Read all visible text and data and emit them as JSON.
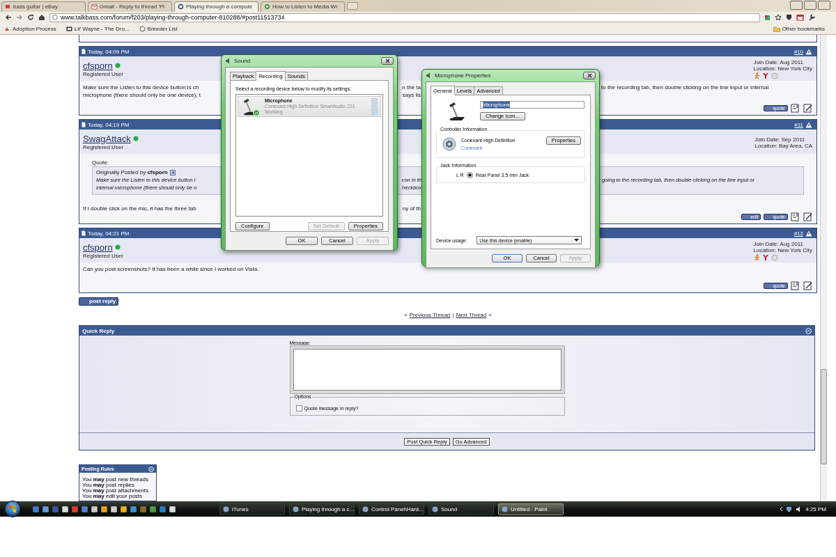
{
  "browser": {
    "tabs": [
      {
        "label": "bass guitar | eBay",
        "selected": false
      },
      {
        "label": "Gmail - Reply to thread 'Pl",
        "selected": false
      },
      {
        "label": "Playing through a compute",
        "selected": true
      },
      {
        "label": "How to Listen to Media Wi",
        "selected": false
      }
    ],
    "address": "www.talkbass.com/forum/f203/playing-through-computer-810288/#post11513734",
    "bookmarks": [
      "Adoption Process",
      "Lil' Wayne - The Dro...",
      "Breeder List"
    ],
    "other_bookmarks": "Other bookmarks"
  },
  "posts": [
    {
      "date": "Today, 04:09 PM",
      "number": "#10",
      "user": "cfsporn",
      "online": true,
      "rank": "Registered User",
      "join_date": "Join Date: Aug 2011",
      "location": "Location: New York City",
      "contact_icons": true,
      "body": [
        [
          "Make sure the Listen to this device button is ch",
          "n the ta",
          "to the recording tab, then double clicking on the line input or internal"
        ],
        [
          "microphone (there should only be one device), t",
          "says lis"
        ]
      ],
      "buttons": [
        "quote"
      ]
    },
    {
      "date": "Today, 04:19 PM",
      "number": "#11",
      "user": "SwagAttack",
      "online": true,
      "rank": "Registered User",
      "join_date": "Join Date: Sep 2011",
      "location": "Location: Bay Area, CA",
      "contact_icons": false,
      "quote": {
        "label": "Quote:",
        "by": "Originally Posted by **cfsporn**",
        "lines": [
          [
            "Make sure the Listen to this device button i",
            "con in th",
            "going to the recording tab, then double clicking on the line input or"
          ],
          [
            "internal microphone (there should only be o",
            "heckbox"
          ]
        ]
      },
      "body": [
        [
          "If I double click on the mic, it has the three tab",
          "ny of th"
        ]
      ],
      "buttons": [
        "edit",
        "quote"
      ]
    },
    {
      "date": "Today, 04:21 PM",
      "number": "#12",
      "user": "cfsporn",
      "online": true,
      "rank": "Registered User",
      "join_date": "Join Date: Aug 2011",
      "location": "Location: New York City",
      "contact_icons": true,
      "body": [
        [
          "Can you post screenshots? It has been a while since I worked on Vista."
        ]
      ],
      "buttons": [
        "quote"
      ]
    }
  ],
  "post_reply": "post reply",
  "thread_nav": {
    "left_mark": "«",
    "previous": "Previous Thread",
    "separator": "|",
    "next": "Next Thread",
    "right_mark": "»"
  },
  "quick_reply": {
    "title": "Quick Reply",
    "message_label": "Message:",
    "options_legend": "Options",
    "quote_option": {
      "label": "Quote message in reply?",
      "checked": false
    },
    "buttons": [
      "Post Quick Reply",
      "Go Advanced"
    ]
  },
  "posting_rules": {
    "title": "Posting Rules",
    "lines": [
      "You **may** post new threads",
      "You **may** post replies",
      "You **may** post attachments",
      "You **may** edit your posts"
    ]
  },
  "sound_dialog": {
    "title": "Sound",
    "tabs": [
      {
        "label": "Playback",
        "selected": false
      },
      {
        "label": "Recording",
        "selected": true
      },
      {
        "label": "Sounds",
        "selected": false
      }
    ],
    "instruction": "Select a recording device below to modify its settings:",
    "devices": [
      {
        "name": "Microphone",
        "description": "Conexant High Definition SmartAudio 221",
        "status": "Working",
        "selected": true,
        "default": true
      }
    ],
    "buttons": [
      {
        "label": "Configure",
        "disabled": false
      },
      {
        "label": "Set Default",
        "disabled": true
      },
      {
        "label": "Properties",
        "disabled": false
      }
    ],
    "footer_buttons": [
      {
        "label": "OK",
        "disabled": false
      },
      {
        "label": "Cancel",
        "disabled": false
      },
      {
        "label": "Apply",
        "disabled": true
      }
    ]
  },
  "mic_dialog": {
    "title": "Microphone Properties",
    "tabs": [
      {
        "label": "General",
        "selected": true
      },
      {
        "label": "Levels",
        "selected": false
      },
      {
        "label": "Advanced",
        "selected": false
      }
    ],
    "name_value": "Microphone",
    "change_icon": "Change Icon...",
    "controller": {
      "legend": "Controller Information",
      "name": "Conexant High Definition",
      "link": "Conexant",
      "button": "Properties"
    },
    "jack": {
      "legend": "Jack Information",
      "channels": "L R",
      "label": "Rear Panel 3.5 mm Jack"
    },
    "usage_label": "Device usage:",
    "usage_value": "Use this device (enable)",
    "footer_buttons": [
      {
        "label": "OK",
        "disabled": false
      },
      {
        "label": "Cancel",
        "disabled": false
      },
      {
        "label": "Apply",
        "disabled": true
      }
    ]
  },
  "taskbar": {
    "tasks": [
      {
        "label": "iTunes",
        "selected": false
      },
      {
        "label": "Playing through a c...",
        "selected": false
      },
      {
        "label": "Control Panel\\Hard...",
        "selected": false
      },
      {
        "label": "Sound",
        "selected": false
      },
      {
        "label": "Untitled - Paint",
        "selected": true
      }
    ],
    "clock": "4:25 PM"
  }
}
